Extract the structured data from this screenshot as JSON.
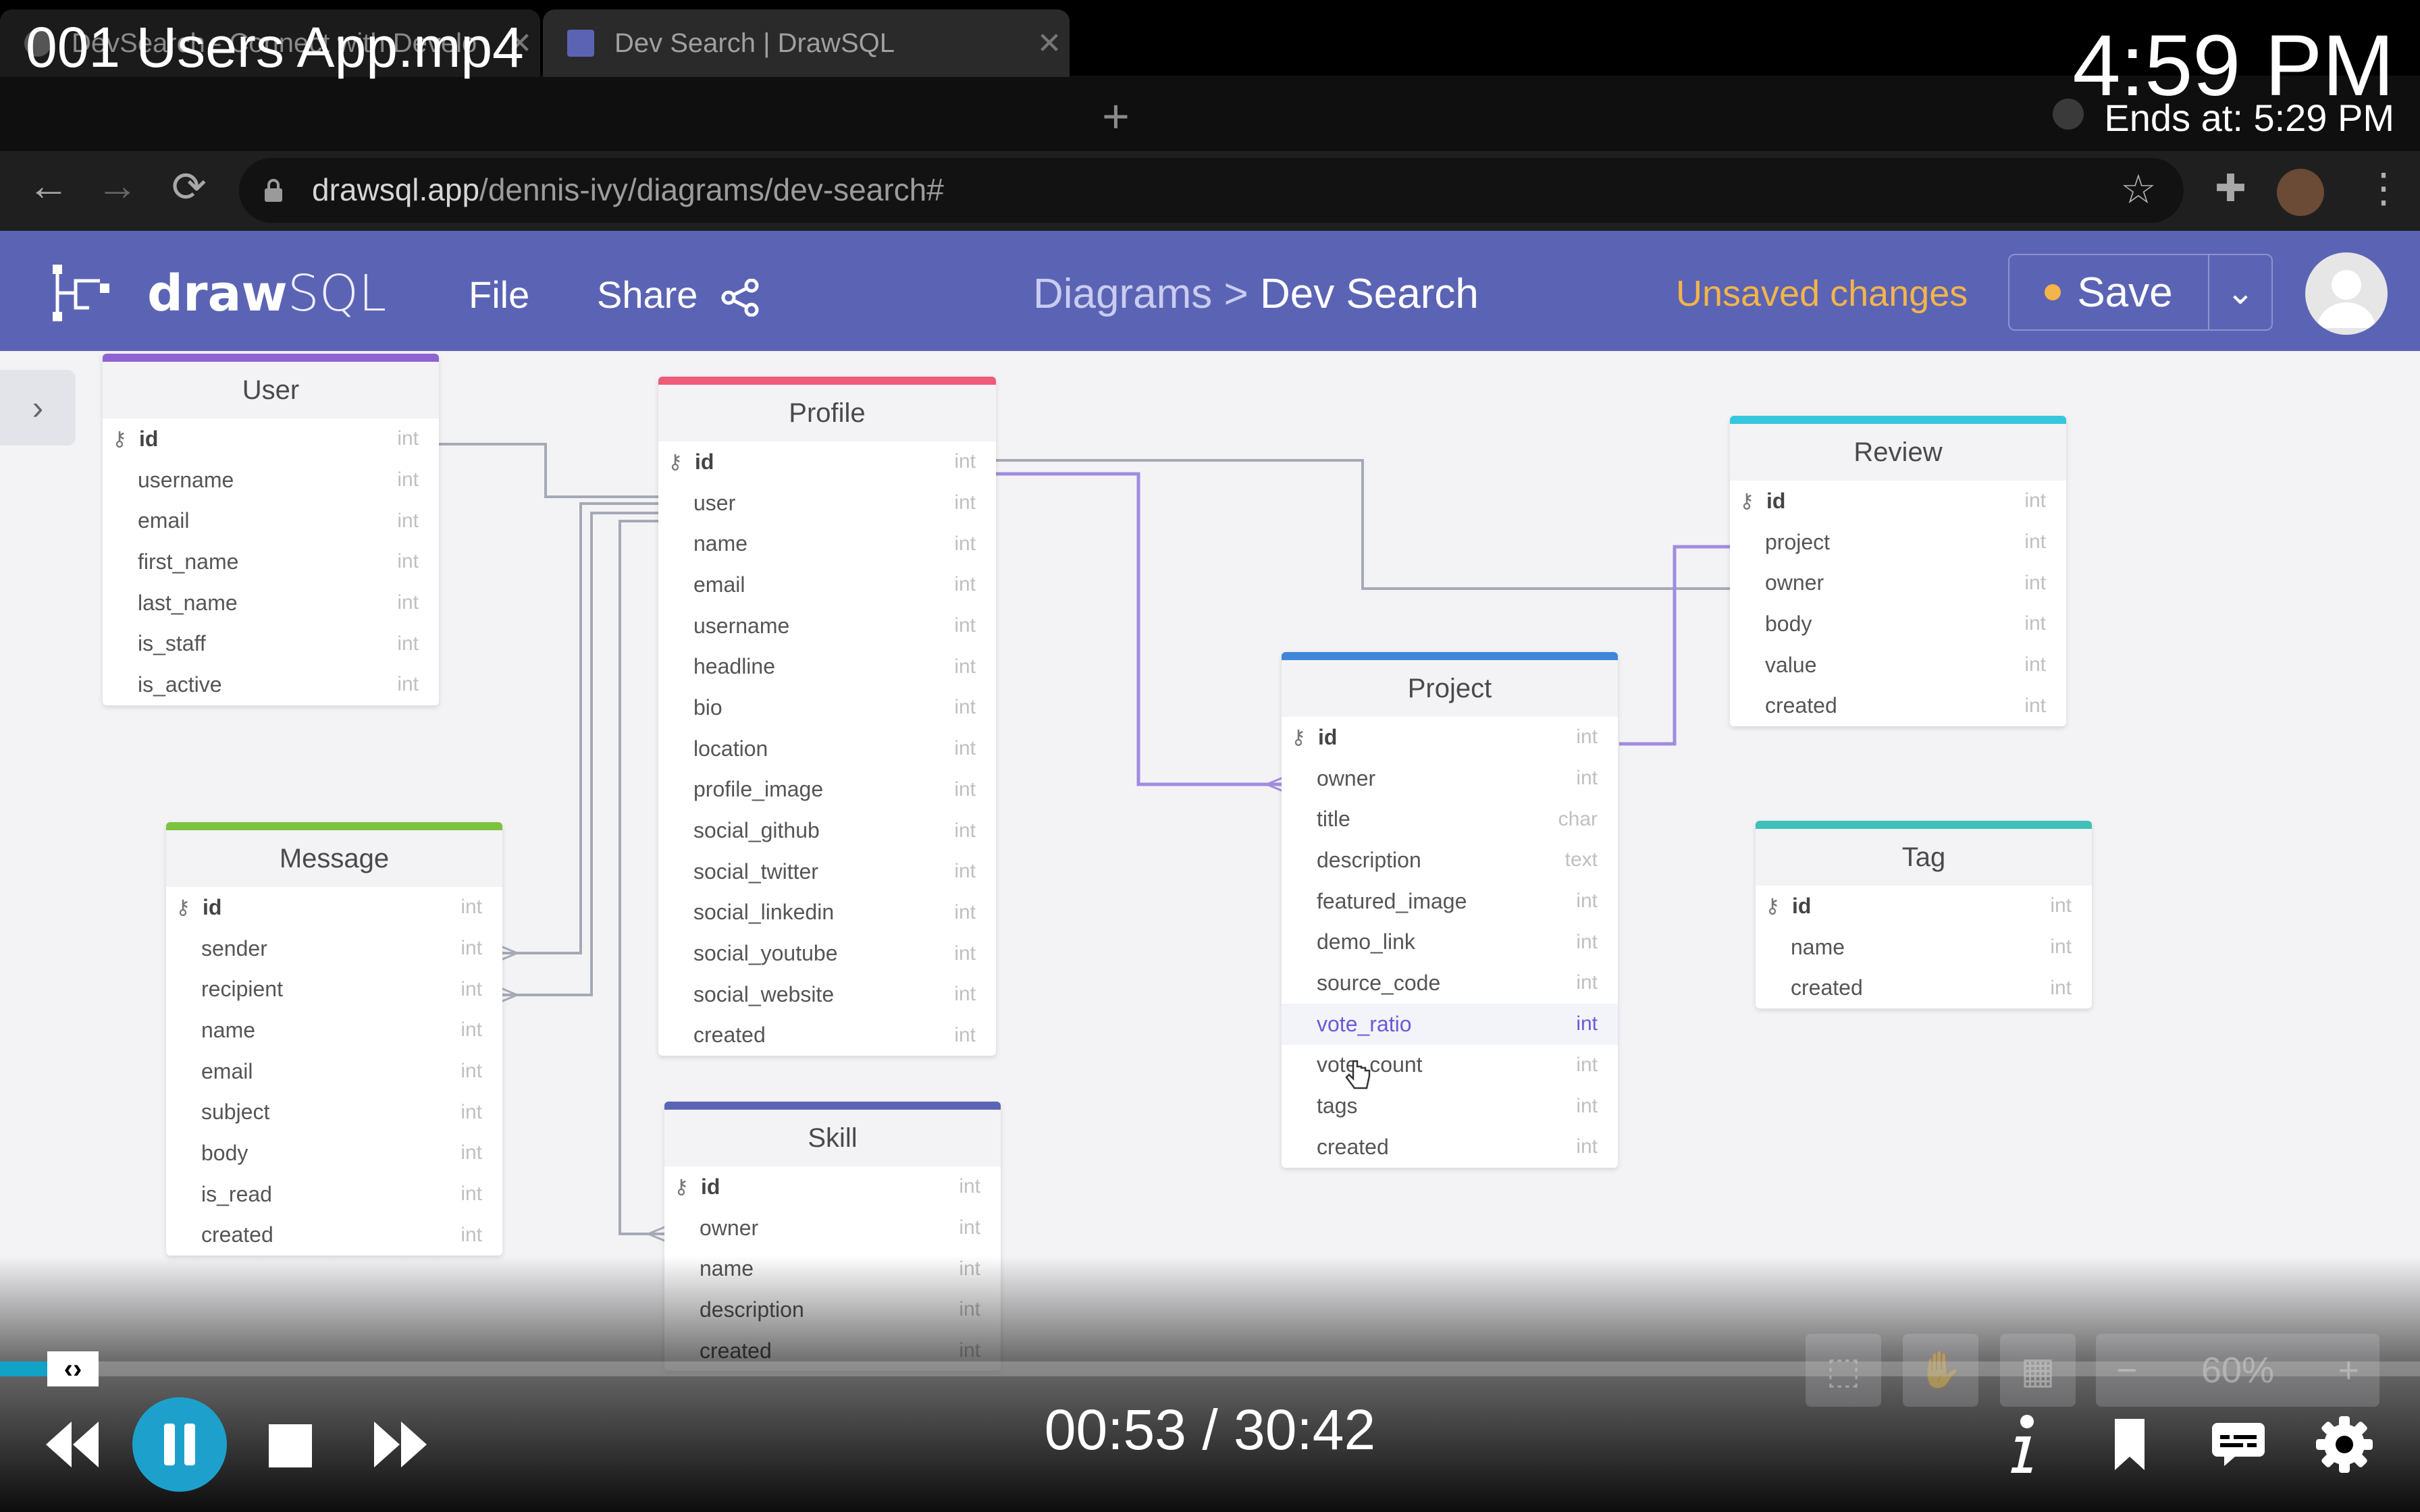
{
  "video": {
    "title": "001 Users App.mp4",
    "clock": "4:59 PM",
    "ends_at": "Ends at: 5:29 PM",
    "timecode": "00:53 / 30:42",
    "progress_fraction": 0.029
  },
  "browser": {
    "tabs": [
      {
        "label": "DevSearch - Connect with Develo",
        "close": "✕"
      },
      {
        "label": "Dev Search | DrawSQL",
        "close": "✕"
      }
    ],
    "new_tab": "+",
    "url_host": "drawsql.app",
    "url_path": "/dennis-ivy/diagrams/dev-search#"
  },
  "app": {
    "brand_bold": "draw",
    "brand_light": "SQL",
    "menu_file": "File",
    "menu_share": "Share",
    "breadcrumb_parent": "Diagrams >",
    "breadcrumb_current": "Dev Search",
    "status": "Unsaved changes",
    "save_label": "Save",
    "zoom": "60%",
    "colors": {
      "header": "#5b64b4",
      "unsaved": "#f3b449",
      "accent": "#6c59d6"
    }
  },
  "tables": {
    "user": {
      "name": "User",
      "color": "#8f63d2",
      "columns": [
        {
          "name": "id",
          "type": "int"
        },
        {
          "name": "username",
          "type": "int"
        },
        {
          "name": "email",
          "type": "int"
        },
        {
          "name": "first_name",
          "type": "int"
        },
        {
          "name": "last_name",
          "type": "int"
        },
        {
          "name": "is_staff",
          "type": "int"
        },
        {
          "name": "is_active",
          "type": "int"
        }
      ]
    },
    "profile": {
      "name": "Profile",
      "color": "#ef5a78",
      "columns": [
        {
          "name": "id",
          "type": "int"
        },
        {
          "name": "user",
          "type": "int"
        },
        {
          "name": "name",
          "type": "int"
        },
        {
          "name": "email",
          "type": "int"
        },
        {
          "name": "username",
          "type": "int"
        },
        {
          "name": "headline",
          "type": "int"
        },
        {
          "name": "bio",
          "type": "int"
        },
        {
          "name": "location",
          "type": "int"
        },
        {
          "name": "profile_image",
          "type": "int"
        },
        {
          "name": "social_github",
          "type": "int"
        },
        {
          "name": "social_twitter",
          "type": "int"
        },
        {
          "name": "social_linkedin",
          "type": "int"
        },
        {
          "name": "social_youtube",
          "type": "int"
        },
        {
          "name": "social_website",
          "type": "int"
        },
        {
          "name": "created",
          "type": "int"
        }
      ]
    },
    "review": {
      "name": "Review",
      "color": "#35c7db",
      "columns": [
        {
          "name": "id",
          "type": "int"
        },
        {
          "name": "project",
          "type": "int"
        },
        {
          "name": "owner",
          "type": "int"
        },
        {
          "name": "body",
          "type": "int"
        },
        {
          "name": "value",
          "type": "int"
        },
        {
          "name": "created",
          "type": "int"
        }
      ]
    },
    "project": {
      "name": "Project",
      "color": "#3f86d8",
      "columns": [
        {
          "name": "id",
          "type": "int"
        },
        {
          "name": "owner",
          "type": "int"
        },
        {
          "name": "title",
          "type": "char"
        },
        {
          "name": "description",
          "type": "text"
        },
        {
          "name": "featured_image",
          "type": "int"
        },
        {
          "name": "demo_link",
          "type": "int"
        },
        {
          "name": "source_code",
          "type": "int"
        },
        {
          "name": "vote_ratio",
          "type": "int"
        },
        {
          "name": "vote_count",
          "type": "int"
        },
        {
          "name": "tags",
          "type": "int"
        },
        {
          "name": "created",
          "type": "int"
        }
      ]
    },
    "message": {
      "name": "Message",
      "color": "#7cc33f",
      "columns": [
        {
          "name": "id",
          "type": "int"
        },
        {
          "name": "sender",
          "type": "int"
        },
        {
          "name": "recipient",
          "type": "int"
        },
        {
          "name": "name",
          "type": "int"
        },
        {
          "name": "email",
          "type": "int"
        },
        {
          "name": "subject",
          "type": "int"
        },
        {
          "name": "body",
          "type": "int"
        },
        {
          "name": "is_read",
          "type": "int"
        },
        {
          "name": "created",
          "type": "int"
        }
      ]
    },
    "skill": {
      "name": "Skill",
      "color": "#5b64b4",
      "columns": [
        {
          "name": "id",
          "type": "int"
        },
        {
          "name": "owner",
          "type": "int"
        },
        {
          "name": "name",
          "type": "int"
        },
        {
          "name": "description",
          "type": "int"
        },
        {
          "name": "created",
          "type": "int"
        }
      ]
    },
    "tag": {
      "name": "Tag",
      "color": "#3fc0b8",
      "columns": [
        {
          "name": "id",
          "type": "int"
        },
        {
          "name": "name",
          "type": "int"
        },
        {
          "name": "created",
          "type": "int"
        }
      ]
    }
  }
}
